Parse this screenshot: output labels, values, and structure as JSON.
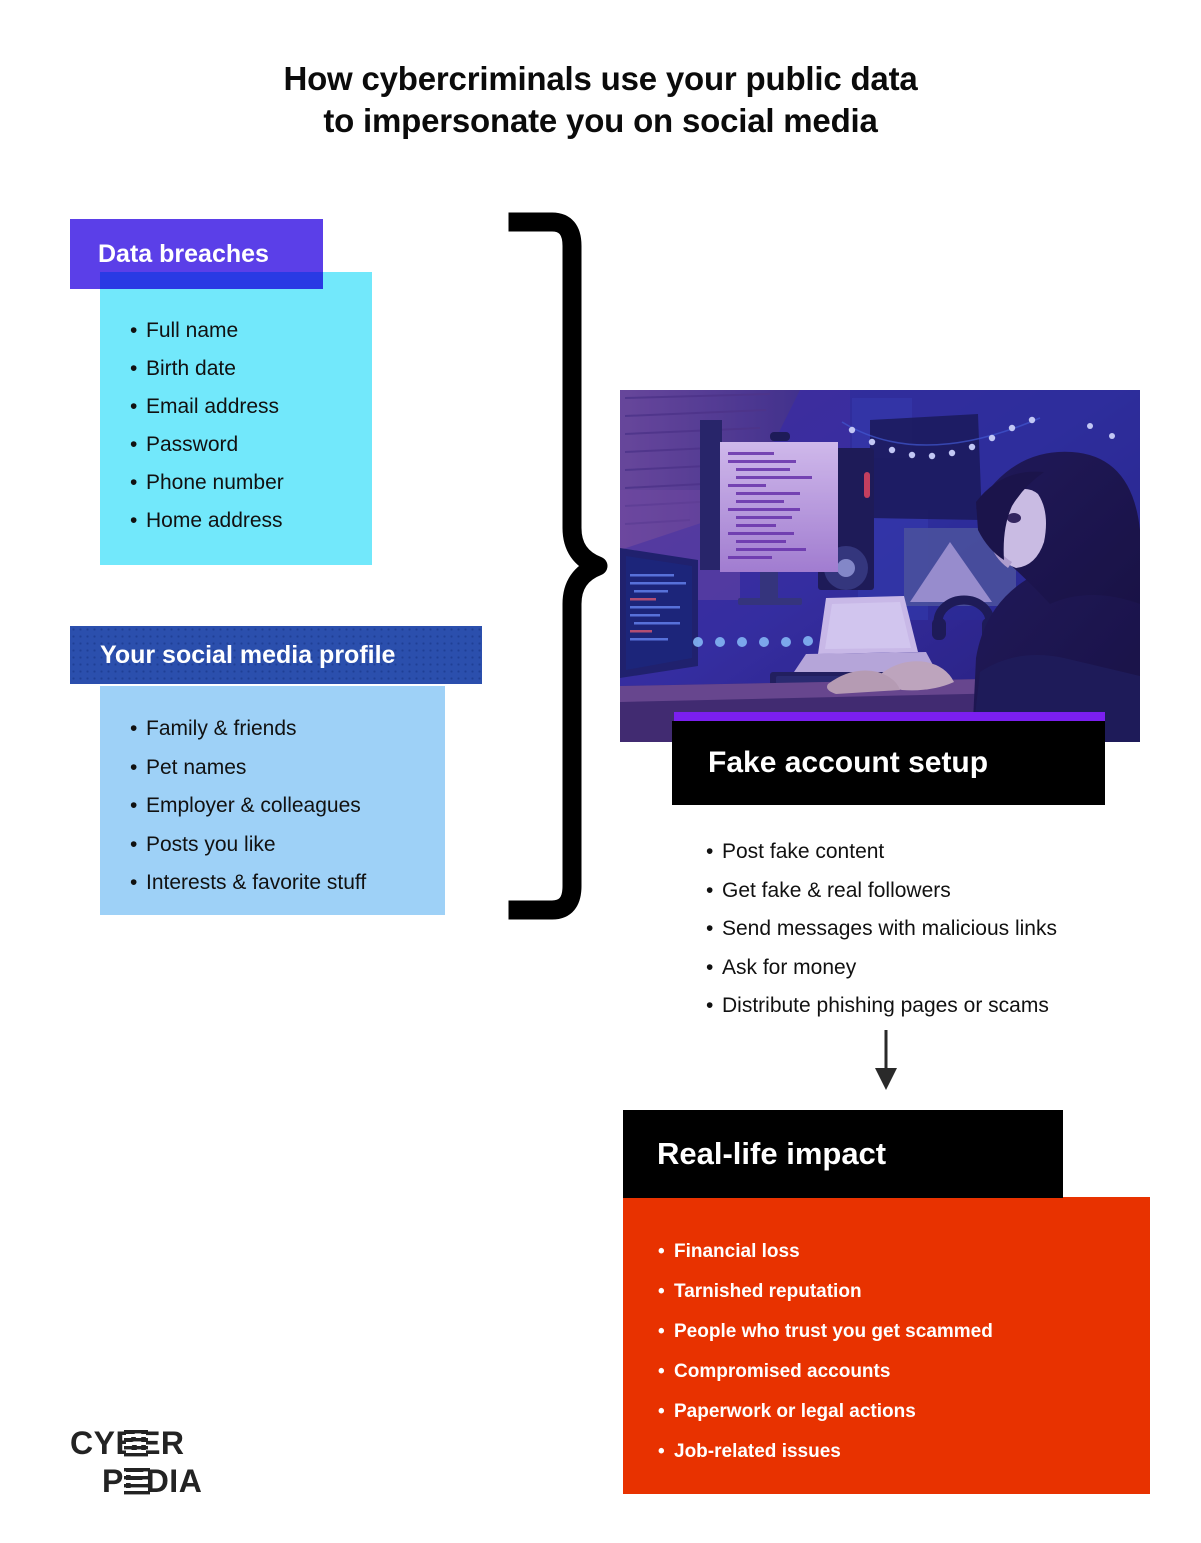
{
  "title": {
    "line1": "How cybercriminals use your public data",
    "line2": "to impersonate you on social media"
  },
  "colors": {
    "breach_header": "#5b3fe8",
    "breach_body": "#72e8fb",
    "social_header": "#2b4fad",
    "social_body": "#9ed1f7",
    "setup_header": "#000000",
    "setup_accent": "#7b1ff0",
    "impact_header": "#000000",
    "impact_body": "#e83200",
    "title_text": "#0b0b0b"
  },
  "data_breaches": {
    "heading": "Data breaches",
    "items": [
      "Full name",
      "Birth date",
      "Email address",
      "Password",
      "Phone number",
      "Home address"
    ]
  },
  "social_profile": {
    "heading": "Your social media profile",
    "items": [
      "Family & friends",
      "Pet names",
      "Employer & colleagues",
      "Posts you like",
      "Interests & favorite stuff"
    ]
  },
  "fake_account": {
    "heading": "Fake account setup",
    "photo_alt": "Hooded person wearing a white mask typing on a laptop at a desk with multiple code-filled monitors lit in blue and purple neon",
    "items": [
      "Post fake content",
      "Get fake & real followers",
      "Send messages with malicious links",
      "Ask for money",
      "Distribute phishing pages or scams"
    ]
  },
  "real_life_impact": {
    "heading": "Real-life impact",
    "items": [
      "Financial loss",
      "Tarnished reputation",
      "People who trust you get scammed",
      "Compromised accounts",
      "Paperwork or legal actions",
      "Job-related issues"
    ]
  },
  "logo": {
    "line1": "CYBER",
    "line2": "PEDIA"
  }
}
